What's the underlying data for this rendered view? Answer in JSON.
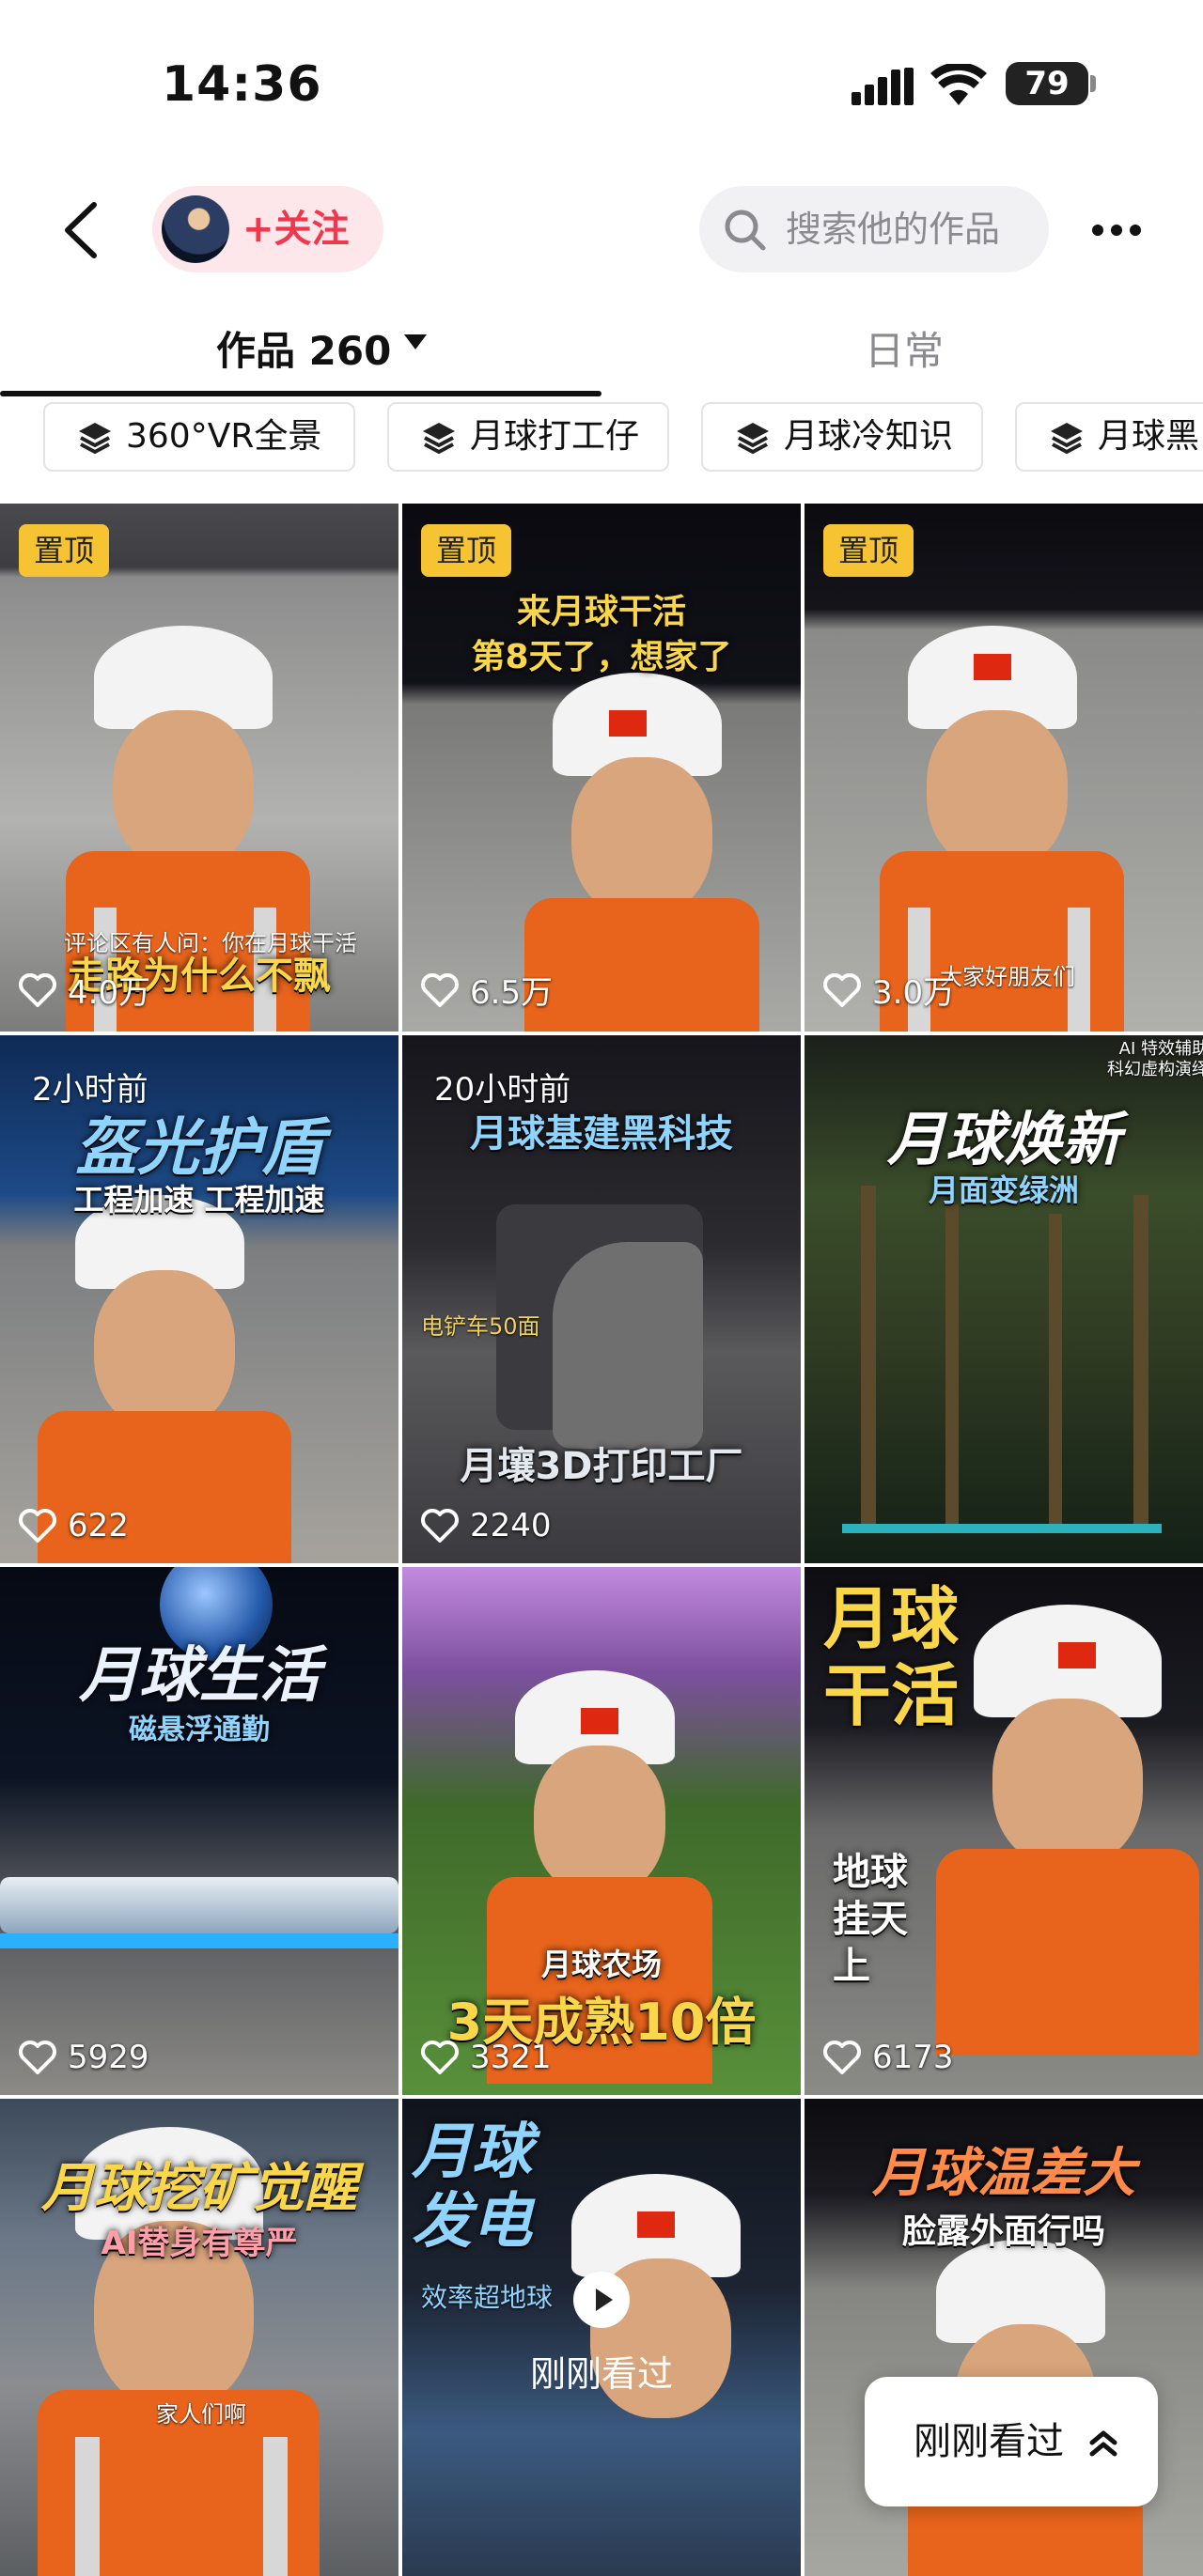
{
  "status_bar": {
    "time": "14:36",
    "battery": "79"
  },
  "header": {
    "follow_label": "+关注",
    "search_placeholder": "搜索他的作品"
  },
  "tabs": [
    {
      "label": "作品 260"
    },
    {
      "label": "日常"
    }
  ],
  "collections": [
    {
      "label": "360°VR全景",
      "icon": "layers-icon"
    },
    {
      "label": "月球打工仔",
      "icon": "layers-icon"
    },
    {
      "label": "月球冷知识",
      "icon": "layers-icon"
    },
    {
      "label": "月球黑",
      "icon": "layers-icon"
    }
  ],
  "videos": [
    {
      "badge": "置顶",
      "likes": "4.0万",
      "caption_small": "评论区有人问：你在月球干活",
      "caption": "走路为什么不飘"
    },
    {
      "badge": "置顶",
      "likes": "6.5万",
      "caption_line1": "来月球干活",
      "caption_line2": "第8天了，想家了"
    },
    {
      "badge": "置顶",
      "likes": "3.0万",
      "caption_small": "大家好朋友们"
    },
    {
      "time_ago": "2小时前",
      "likes": "622",
      "title": "盔光护盾",
      "subtitle": "工程加速 工程加速"
    },
    {
      "time_ago": "20小时前",
      "likes": "2240",
      "title": "月壤3D打印工厂",
      "subtitle": "月球基建黑科技",
      "caption": "月壤3D打印工厂",
      "tag": "电铲车50面"
    },
    {
      "likes": "",
      "title": "月球焕新",
      "subtitle": "月面变绿洲",
      "corner": "AI 特效辅助\n科幻虚构演绎"
    },
    {
      "likes": "5929",
      "title": "月球生活",
      "subtitle": "磁悬浮通勤"
    },
    {
      "likes": "3321",
      "caption_small": "月球农场",
      "caption": "3天成熟10倍"
    },
    {
      "likes": "6173",
      "title": "月球干活",
      "subtitle": "地球挂天上"
    },
    {
      "title": "月球挖矿觉醒",
      "subtitle": "AI替身有尊严",
      "caption_small": "家人们啊"
    },
    {
      "title": "月球发电",
      "subtitle": "效率超地球",
      "seen_label": "刚刚看过"
    },
    {
      "title": "月球温差大",
      "subtitle": "脸露外面行吗"
    }
  ],
  "recently_viewed_button": "刚刚看过",
  "colors": {
    "follow_bg": "#fde7ea",
    "follow_text": "#f0374e",
    "badge": "#f6c432"
  }
}
